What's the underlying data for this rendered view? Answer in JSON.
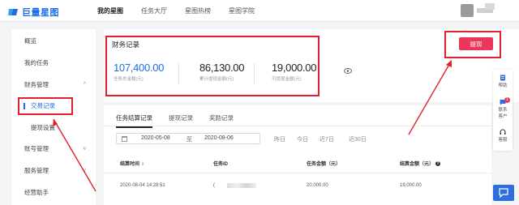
{
  "app": {
    "logo_text": "巨量星图"
  },
  "nav": [
    "我的星图",
    "任务大厅",
    "星图热榜",
    "星图学院"
  ],
  "sidebar": {
    "items": [
      {
        "label": "概览"
      },
      {
        "label": "我的任务"
      },
      {
        "label": "财务管理",
        "chev": "^"
      },
      {
        "label": "交易记录"
      },
      {
        "label": "提现设置"
      },
      {
        "label": "账号管理",
        "chev": "v"
      },
      {
        "label": "服务管理",
        "chev": "v"
      },
      {
        "label": "经营助手"
      }
    ]
  },
  "finance": {
    "title": "财务记录",
    "stats": [
      {
        "value": "107,400.00",
        "label": "任务总金额(元)"
      },
      {
        "value": "86,130.00",
        "label": "累计提现金额(元)"
      },
      {
        "value": "19,000.00",
        "label": "可提现金额(元)"
      }
    ],
    "withdraw_label": "提现"
  },
  "records": {
    "tabs": [
      "任务结算记录",
      "提现记录",
      "奖励记录"
    ],
    "date_start": "2020-05-08",
    "date_to": "至",
    "date_end": "2020-08-06",
    "quick": [
      "昨日",
      "今日",
      "近7日",
      "近30日"
    ],
    "headers": [
      "结算时间",
      "任务ID",
      "任务金额（元）",
      "结算金额（元）"
    ],
    "sort_glyph": "⇕",
    "help_glyph": "?",
    "row": {
      "time": "2020-08-04 14:28:51",
      "id_prefix": "(",
      "task_amount": "20,000.00",
      "settle_amount": "19,000.00"
    }
  },
  "float": {
    "items": [
      {
        "label": "帮助"
      },
      {
        "label": "联系\n客户",
        "badge": "1"
      },
      {
        "label": "客服"
      }
    ]
  },
  "colors": {
    "accent": "#1a6ee8",
    "brand_red": "#e8375a",
    "annotation": "#e41f2b"
  }
}
